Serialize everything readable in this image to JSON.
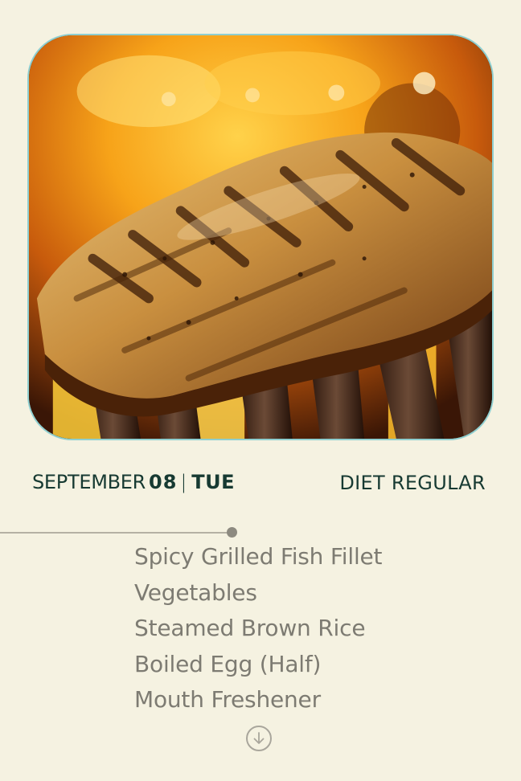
{
  "hero": {
    "image_description_icon": "grilled-fish-photo"
  },
  "date": {
    "month": "SEPTEMBER",
    "day": "08",
    "separator": "|",
    "weekday": "TUE"
  },
  "diet": {
    "label": "DIET REGULAR"
  },
  "menu": {
    "items": [
      "Spicy Grilled Fish Fillet",
      "Vegetables",
      "Steamed Brown Rice",
      "Boiled Egg (Half)",
      "Mouth Freshener"
    ]
  },
  "scroll": {
    "icon": "arrow-down-circle-icon"
  },
  "colors": {
    "background": "#f5f2e1",
    "heading_text": "#173a32",
    "menu_text": "#7d7b72",
    "frame_border": "#8fcfd0"
  }
}
